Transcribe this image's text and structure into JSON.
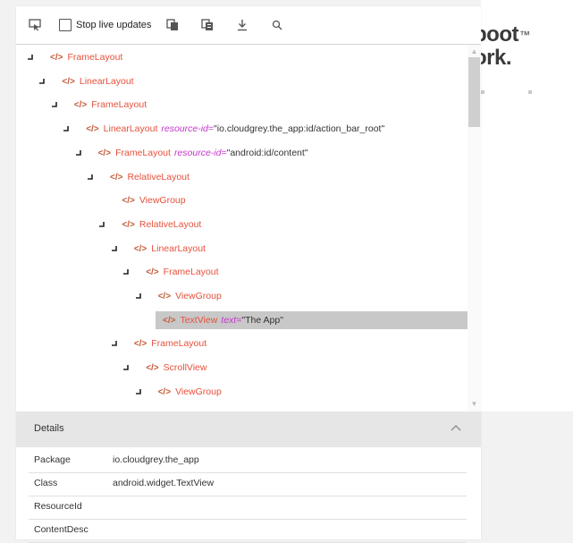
{
  "background_app": {
    "brand_text": "boot",
    "brand_text_2": "ork.",
    "brand_tm": "™"
  },
  "toolbar": {
    "stop_live_updates_label": "Stop live updates",
    "stop_live_updates_checked": false
  },
  "tree": {
    "nodes": [
      {
        "tag": "FrameLayout",
        "expanded": true
      },
      {
        "tag": "LinearLayout",
        "expanded": true
      },
      {
        "tag": "FrameLayout",
        "expanded": true
      },
      {
        "tag": "LinearLayout",
        "attr_name": "resource-id",
        "attr_value": "\"io.cloudgrey.the_app:id/action_bar_root\"",
        "expanded": true
      },
      {
        "tag": "FrameLayout",
        "attr_name": "resource-id",
        "attr_value": "\"android:id/content\"",
        "expanded": true
      },
      {
        "tag": "RelativeLayout",
        "expanded": true
      },
      {
        "tag": "ViewGroup",
        "expanded": null
      },
      {
        "tag": "RelativeLayout",
        "expanded": true
      },
      {
        "tag": "LinearLayout",
        "expanded": true
      },
      {
        "tag": "FrameLayout",
        "expanded": true
      },
      {
        "tag": "ViewGroup",
        "expanded": true
      },
      {
        "tag": "TextView",
        "attr_name": "text",
        "attr_value": "\"The App\"",
        "expanded": null,
        "selected": true
      },
      {
        "tag": "FrameLayout",
        "expanded": true
      },
      {
        "tag": "ScrollView",
        "expanded": true
      },
      {
        "tag": "ViewGroup",
        "expanded": true
      }
    ]
  },
  "details": {
    "title": "Details",
    "properties": [
      {
        "key": "Package",
        "value": "io.cloudgrey.the_app"
      },
      {
        "key": "Class",
        "value": "android.widget.TextView"
      },
      {
        "key": "ResourceId",
        "value": ""
      },
      {
        "key": "ContentDesc",
        "value": ""
      }
    ]
  }
}
